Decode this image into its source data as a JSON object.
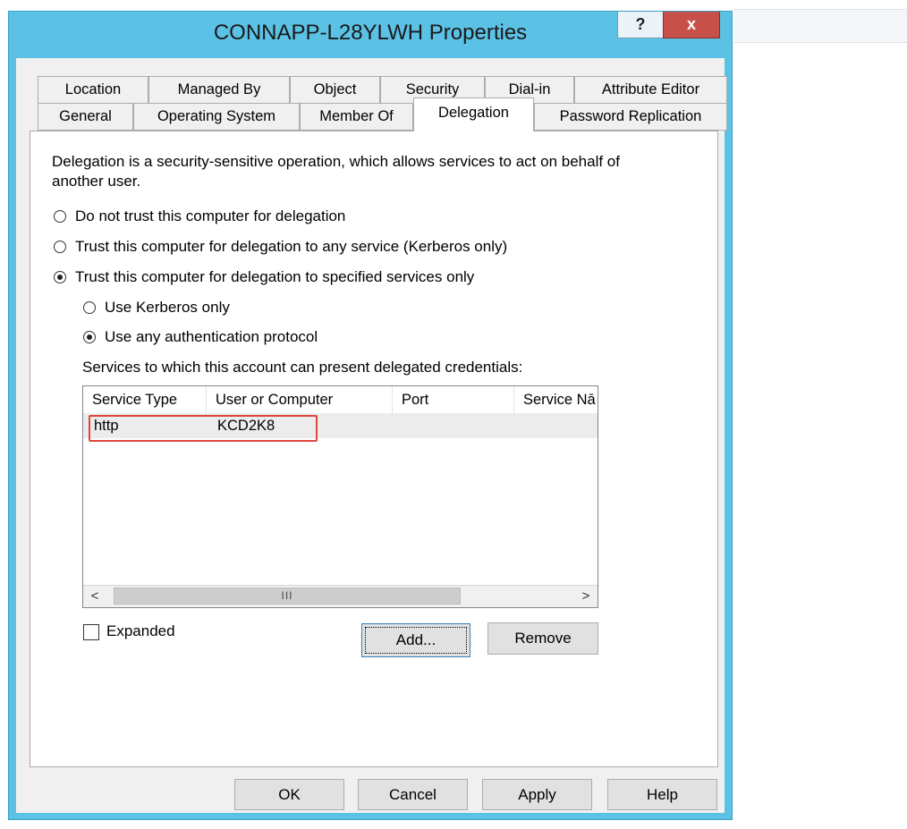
{
  "window": {
    "title": "CONNAPP-L28YLWH Properties",
    "help_symbol": "?",
    "close_symbol": "x"
  },
  "tabs": {
    "row1": [
      "Location",
      "Managed By",
      "Object",
      "Security",
      "Dial-in",
      "Attribute Editor"
    ],
    "row2": [
      "General",
      "Operating System",
      "Member Of",
      "Delegation",
      "Password Replication"
    ],
    "selected": "Delegation"
  },
  "delegation": {
    "description": "Delegation is a security-sensitive operation, which allows services to act on behalf of another user.",
    "options": [
      {
        "label": "Do not trust this computer for delegation",
        "selected": false
      },
      {
        "label": "Trust this computer for delegation to any service (Kerberos only)",
        "selected": false
      },
      {
        "label": "Trust this computer for delegation to specified services only",
        "selected": true
      }
    ],
    "sub_options": [
      {
        "label": "Use Kerberos only",
        "selected": false
      },
      {
        "label": "Use any authentication protocol",
        "selected": true
      }
    ],
    "services_label": "Services to which this account can present delegated credentials:",
    "columns": [
      "Service Type",
      "User or Computer",
      "Port",
      "Service Nā"
    ],
    "rows": [
      {
        "service_type": "http",
        "user_or_computer": "KCD2K8",
        "port": "",
        "service_name": ""
      }
    ],
    "scroll": {
      "left": "<",
      "right": ">",
      "grip": "III"
    },
    "expanded_label": "Expanded",
    "expanded_checked": false,
    "add_label": "Add...",
    "remove_label": "Remove"
  },
  "footer": {
    "ok": "OK",
    "cancel": "Cancel",
    "apply": "Apply",
    "help": "Help"
  },
  "colors": {
    "titlebar": "#5bc2e6",
    "close_button": "#c7514a",
    "highlight_box": "#e0473c"
  }
}
